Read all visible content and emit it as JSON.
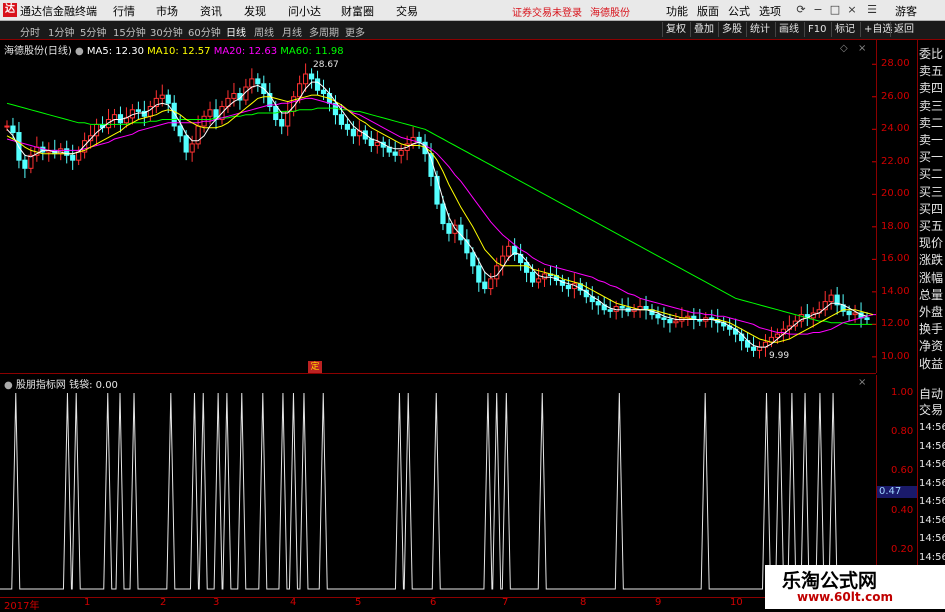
{
  "titlebar": {
    "app_name": "通达信金融终端",
    "menus": [
      "行情",
      "市场",
      "资讯",
      "发现",
      "问小达",
      "财富圈",
      "交易"
    ],
    "status_msg": "证券交易未登录",
    "stock_name": "海德股份",
    "right_menus": [
      "功能",
      "版面",
      "公式",
      "选项"
    ],
    "user": "游客"
  },
  "toolbar": {
    "period_tabs": [
      "分时",
      "1分钟",
      "5分钟",
      "15分钟",
      "30分钟",
      "60分钟",
      "日线",
      "周线",
      "月线",
      "多周期",
      "更多"
    ],
    "active_tab": "日线",
    "right_buttons": [
      "复权",
      "叠加",
      "多股",
      "统计",
      "画线",
      "F10",
      "标记",
      "+自选",
      "返回"
    ]
  },
  "legend_main": {
    "title": "海德股份(日线)",
    "items": [
      {
        "label": "MA5: 12.30",
        "color": "#ffffff"
      },
      {
        "label": "MA10: 12.57",
        "color": "#ffff00"
      },
      {
        "label": "MA20: 12.63",
        "color": "#ff00ff"
      },
      {
        "label": "MA60: 11.98",
        "color": "#00ff00"
      }
    ]
  },
  "legend_sub": {
    "title": "股朋指标网",
    "value_label": "钱袋: 0.00"
  },
  "annotations": {
    "high": "28.67",
    "low": "9.99",
    "ding": "定"
  },
  "main_axis_ticks": [
    "28.00",
    "26.00",
    "24.00",
    "22.00",
    "20.00",
    "18.00",
    "16.00",
    "14.00",
    "12.00",
    "10.00"
  ],
  "sub_axis_ticks": [
    "1.00",
    "0.80",
    "0.60",
    "0.40",
    "0.20"
  ],
  "sub_value_box": "0.47",
  "x_ticks": [
    "2017年",
    "1",
    "2",
    "3",
    "4",
    "5",
    "6",
    "7",
    "8",
    "9",
    "10"
  ],
  "right_panel_labels": [
    "委比",
    "卖五",
    "卖四",
    "卖三",
    "卖二",
    "卖一",
    "买一",
    "买二",
    "买三",
    "买四",
    "买五",
    "现价",
    "涨跌",
    "涨幅",
    "总量",
    "外盘",
    "换手",
    "净资",
    "收益"
  ],
  "right_panel_sub": [
    "自动",
    "交易"
  ],
  "time_labels": [
    "14:56",
    "14:56",
    "14:56",
    "14:56",
    "14:56",
    "14:56",
    "14:56",
    "14:56"
  ],
  "watermark": {
    "line1": "乐淘公式网",
    "line2": "www.60lt.com"
  },
  "chart_data": {
    "type": "candlestick",
    "ylim": [
      9.5,
      29
    ],
    "closes": [
      24.2,
      23.8,
      22.1,
      21.6,
      22.4,
      22.9,
      22.6,
      22.7,
      22.5,
      22.8,
      22.4,
      22.1,
      22.6,
      23.3,
      23.6,
      24.3,
      24.1,
      24.6,
      24.9,
      24.4,
      24.7,
      25.2,
      25.1,
      24.8,
      25.4,
      25.9,
      26.1,
      25.6,
      24.2,
      23.6,
      22.6,
      23.1,
      24.2,
      24.8,
      25.2,
      24.6,
      25.4,
      25.9,
      26.2,
      25.8,
      26.6,
      27.1,
      26.8,
      26.2,
      25.4,
      24.6,
      24.2,
      25.1,
      26.0,
      26.8,
      27.4,
      27.1,
      26.4,
      26.2,
      25.6,
      24.9,
      24.3,
      24.0,
      23.6,
      23.9,
      23.4,
      23.0,
      23.2,
      22.9,
      22.6,
      22.4,
      22.7,
      23.1,
      23.5,
      23.2,
      22.5,
      21.1,
      19.4,
      18.2,
      17.6,
      18.1,
      17.2,
      16.4,
      15.6,
      14.6,
      14.2,
      14.8,
      15.6,
      16.2,
      16.8,
      16.3,
      15.8,
      15.2,
      14.6,
      14.8,
      15.1,
      15.0,
      14.7,
      14.4,
      14.2,
      14.5,
      14.1,
      13.7,
      13.4,
      13.2,
      12.9,
      12.8,
      13.1,
      13.0,
      12.8,
      12.9,
      13.1,
      12.9,
      12.6,
      12.4,
      12.3,
      12.1,
      12.2,
      12.4,
      12.5,
      12.3,
      12.2,
      12.4,
      12.3,
      12.1,
      11.9,
      11.7,
      11.4,
      11.0,
      10.6,
      10.4,
      10.6,
      10.9,
      11.2,
      11.4,
      11.7,
      11.9,
      12.2,
      12.6,
      12.4,
      12.7,
      12.9,
      13.4,
      13.8,
      13.2,
      12.8,
      12.6,
      12.7,
      12.4,
      12.3
    ],
    "ma5": [
      24.0,
      23.6,
      22.9,
      22.4,
      22.3,
      22.5,
      22.7,
      22.7,
      22.6,
      22.6,
      22.5,
      22.5,
      22.6,
      23.0,
      23.4,
      23.8,
      24.1,
      24.4,
      24.6,
      24.6,
      24.7,
      24.9,
      25.0,
      25.0,
      25.2,
      25.5,
      25.6,
      25.5,
      25.0,
      24.4,
      23.7,
      23.3,
      23.3,
      23.6,
      24.2,
      24.6,
      25.0,
      25.4,
      25.7,
      25.9,
      26.3,
      26.6,
      26.7,
      26.5,
      26.1,
      25.5,
      25.0,
      25.0,
      25.4,
      25.9,
      26.5,
      26.9,
      26.9,
      26.6,
      26.2,
      25.7,
      25.2,
      24.7,
      24.2,
      23.9,
      23.7,
      23.4,
      23.3,
      23.1,
      22.9,
      22.8,
      22.8,
      22.9,
      23.1,
      23.2,
      23.0,
      22.2,
      21.0,
      19.7,
      18.6,
      17.9,
      17.5,
      17.1,
      16.6,
      15.9,
      15.2,
      14.9,
      15.0,
      15.5,
      16.1,
      16.4,
      16.3,
      15.9,
      15.4,
      15.0,
      14.9,
      14.9,
      14.8,
      14.6,
      14.5,
      14.4,
      14.2,
      14.0,
      13.7,
      13.5,
      13.2,
      13.0,
      12.9,
      12.9,
      12.9,
      12.9,
      12.9,
      12.9,
      12.8,
      12.7,
      12.5,
      12.4,
      12.3,
      12.3,
      12.3,
      12.3,
      12.3,
      12.3,
      12.3,
      12.2,
      12.1,
      11.9,
      11.7,
      11.4,
      11.0,
      10.7,
      10.6,
      10.6,
      10.8,
      11.1,
      11.4,
      11.7,
      12.0,
      12.3,
      12.4,
      12.6,
      12.7,
      13.0,
      13.3,
      13.3,
      13.2,
      13.0,
      12.8,
      12.6,
      12.5
    ],
    "ma10": [
      23.6,
      23.4,
      23.2,
      22.9,
      22.7,
      22.6,
      22.5,
      22.5,
      22.5,
      22.5,
      22.5,
      22.5,
      22.6,
      22.7,
      22.9,
      23.1,
      23.3,
      23.5,
      23.7,
      23.9,
      24.2,
      24.4,
      24.6,
      24.7,
      24.8,
      24.9,
      25.1,
      25.2,
      25.1,
      24.9,
      24.6,
      24.4,
      24.2,
      24.1,
      24.1,
      24.1,
      24.2,
      24.4,
      24.7,
      25.0,
      25.3,
      25.6,
      25.9,
      26.0,
      26.0,
      25.9,
      25.8,
      25.7,
      25.8,
      25.9,
      26.0,
      26.1,
      26.1,
      26.0,
      25.9,
      25.7,
      25.5,
      25.2,
      24.9,
      24.6,
      24.4,
      24.1,
      23.9,
      23.7,
      23.5,
      23.3,
      23.1,
      23.0,
      23.0,
      23.0,
      22.9,
      22.6,
      22.1,
      21.4,
      20.6,
      19.9,
      19.2,
      18.6,
      18.0,
      17.3,
      16.6,
      16.2,
      15.8,
      15.6,
      15.6,
      15.6,
      15.6,
      15.6,
      15.4,
      15.3,
      15.2,
      15.1,
      15.0,
      14.8,
      14.7,
      14.6,
      14.5,
      14.3,
      14.1,
      13.9,
      13.7,
      13.5,
      13.3,
      13.2,
      13.1,
      13.0,
      12.9,
      12.9,
      12.9,
      12.8,
      12.7,
      12.6,
      12.5,
      12.4,
      12.4,
      12.3,
      12.3,
      12.3,
      12.3,
      12.3,
      12.2,
      12.1,
      11.9,
      11.7,
      11.5,
      11.3,
      11.1,
      11.0,
      10.9,
      10.9,
      11.0,
      11.1,
      11.3,
      11.5,
      11.7,
      11.9,
      12.1,
      12.3,
      12.5,
      12.7,
      12.9,
      12.9,
      12.9,
      12.8,
      12.7,
      12.6
    ],
    "ma20": [
      23.4,
      23.3,
      23.2,
      23.1,
      23.0,
      22.9,
      22.8,
      22.7,
      22.7,
      22.7,
      22.7,
      22.7,
      22.7,
      22.8,
      22.9,
      23.0,
      23.1,
      23.2,
      23.4,
      23.5,
      23.6,
      23.7,
      23.9,
      24.0,
      24.1,
      24.2,
      24.3,
      24.4,
      24.4,
      24.4,
      24.4,
      24.4,
      24.4,
      24.5,
      24.5,
      24.6,
      24.7,
      24.8,
      24.9,
      25.0,
      25.1,
      25.2,
      25.3,
      25.4,
      25.5,
      25.5,
      25.6,
      25.6,
      25.7,
      25.8,
      25.9,
      25.9,
      25.8,
      25.7,
      25.6,
      25.5,
      25.4,
      25.2,
      25.0,
      24.9,
      24.7,
      24.5,
      24.3,
      24.1,
      23.9,
      23.7,
      23.5,
      23.4,
      23.3,
      23.2,
      23.0,
      22.8,
      22.5,
      22.1,
      21.7,
      21.2,
      20.8,
      20.3,
      19.8,
      19.3,
      18.8,
      18.3,
      17.9,
      17.5,
      17.2,
      16.9,
      16.6,
      16.4,
      16.1,
      15.9,
      15.7,
      15.6,
      15.5,
      15.4,
      15.3,
      15.2,
      15.1,
      15.0,
      14.9,
      14.7,
      14.6,
      14.4,
      14.3,
      14.1,
      13.9,
      13.8,
      13.6,
      13.5,
      13.4,
      13.3,
      13.2,
      13.1,
      13.0,
      12.9,
      12.8,
      12.7,
      12.7,
      12.6,
      12.6,
      12.5,
      12.5,
      12.4,
      12.3,
      12.2,
      12.1,
      12.0,
      11.8,
      11.7,
      11.6,
      11.5,
      11.5,
      11.4,
      11.4,
      11.4,
      11.4,
      11.5,
      11.5,
      11.6,
      11.7,
      11.9,
      12.1,
      12.2,
      12.3,
      12.4,
      12.5,
      12.6,
      12.6
    ],
    "ma60": [
      25.6,
      25.5,
      25.4,
      25.3,
      25.2,
      25.1,
      25.0,
      24.9,
      24.8,
      24.7,
      24.6,
      24.5,
      24.4,
      24.4,
      24.3,
      24.3,
      24.3,
      24.3,
      24.3,
      24.3,
      24.3,
      24.4,
      24.4,
      24.4,
      24.5,
      24.5,
      24.6,
      24.6,
      24.6,
      24.6,
      24.6,
      24.6,
      24.6,
      24.6,
      24.6,
      24.7,
      24.7,
      24.7,
      24.8,
      24.8,
      24.9,
      24.9,
      25.0,
      25.0,
      25.0,
      25.0,
      25.1,
      25.1,
      25.1,
      25.2,
      25.2,
      25.2,
      25.3,
      25.3,
      25.3,
      25.3,
      25.2,
      25.2,
      25.1,
      25.1,
      25.0,
      24.9,
      24.8,
      24.7,
      24.6,
      24.5,
      24.4,
      24.3,
      24.2,
      24.1,
      24.0,
      23.8,
      23.6,
      23.4,
      23.2,
      23.0,
      22.8,
      22.6,
      22.4,
      22.2,
      22.0,
      21.8,
      21.6,
      21.4,
      21.2,
      21.0,
      20.8,
      20.6,
      20.4,
      20.2,
      20.0,
      19.8,
      19.6,
      19.4,
      19.2,
      19.0,
      18.8,
      18.6,
      18.4,
      18.2,
      18.0,
      17.8,
      17.6,
      17.4,
      17.2,
      17.0,
      16.8,
      16.6,
      16.4,
      16.2,
      16.0,
      15.8,
      15.6,
      15.4,
      15.2,
      15.0,
      14.8,
      14.6,
      14.4,
      14.2,
      14.0,
      13.8,
      13.6,
      13.5,
      13.4,
      13.3,
      13.2,
      13.1,
      13.0,
      12.9,
      12.8,
      12.7,
      12.6,
      12.5,
      12.4,
      12.3,
      12.2,
      12.2,
      12.1,
      12.1,
      12.1,
      12.0,
      12.0,
      12.0,
      12.0,
      12.0,
      12.0
    ],
    "signal_positions": [
      0.018,
      0.077,
      0.087,
      0.123,
      0.137,
      0.153,
      0.195,
      0.222,
      0.232,
      0.249,
      0.259,
      0.276,
      0.3,
      0.323,
      0.335,
      0.347,
      0.369,
      0.456,
      0.466,
      0.498,
      0.557,
      0.567,
      0.578,
      0.619,
      0.707,
      0.805,
      0.875,
      0.89,
      0.904,
      0.919,
      0.936,
      0.951
    ],
    "signal_range": [
      0,
      1
    ]
  }
}
